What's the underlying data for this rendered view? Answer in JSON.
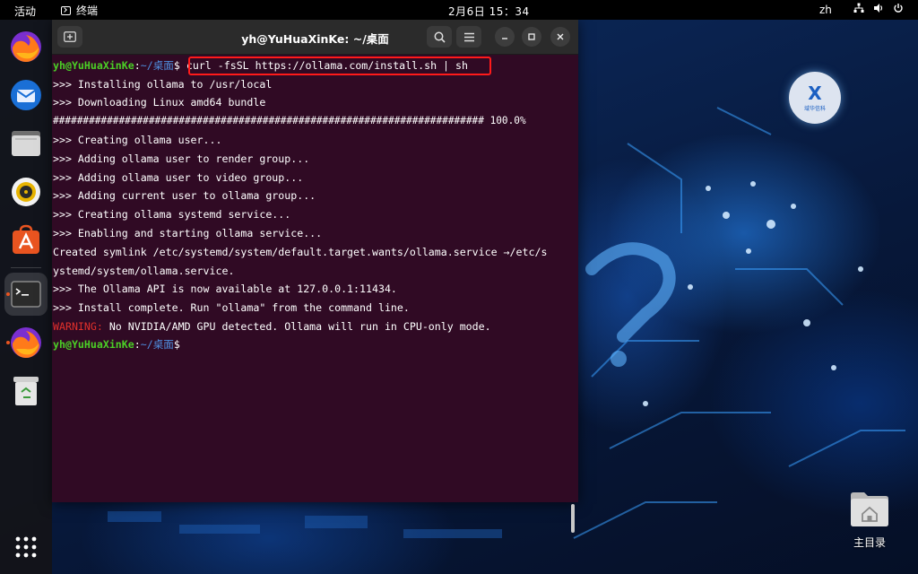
{
  "topbar": {
    "activities": "活动",
    "app_name": "终端",
    "clock": "2月6日  15：34",
    "lang": "zh",
    "icons": [
      "network-icon",
      "volume-icon",
      "power-icon"
    ]
  },
  "dock": {
    "apps": [
      "firefox",
      "thunderbird",
      "files",
      "rhythmbox",
      "app-center",
      "terminal",
      "firefox",
      "trash"
    ],
    "active": "terminal"
  },
  "terminal": {
    "title": "yh@YuHuaXinKe: ~/桌面",
    "prompt": {
      "user": "yh@YuHuaXinKe",
      "sep": ":",
      "path": "~/桌面",
      "symbol": "$"
    },
    "command": "curl -fsSL https://ollama.com/install.sh | sh",
    "output": [
      ">>> Installing ollama to /usr/local",
      ">>> Downloading Linux amd64 bundle",
      "######################################################################## 100.0%",
      ">>> Creating ollama user...",
      ">>> Adding ollama user to render group...",
      ">>> Adding ollama user to video group...",
      ">>> Adding current user to ollama group...",
      ">>> Creating ollama systemd service...",
      ">>> Enabling and starting ollama service...",
      "Created symlink /etc/systemd/system/default.target.wants/ollama.service →/etc/s",
      "ystemd/system/ollama.service.",
      ">>> The Ollama API is now available at 127.0.0.1:11434.",
      ">>> Install complete. Run \"ollama\" from the command line."
    ],
    "warning_label": "WARNING:",
    "warning_text": " No NVIDIA/AMD GPU detected. Ollama will run in CPU-only mode."
  },
  "desktop": {
    "logo_mark": "X",
    "logo_text": "域华信科",
    "home_folder_label": "主目录"
  },
  "colors": {
    "terminal_bg": "#300a24",
    "prompt_user": "#4bd026",
    "prompt_path": "#4f8fe0",
    "warning": "#e0302b",
    "highlight_box": "#ff1a1a"
  }
}
